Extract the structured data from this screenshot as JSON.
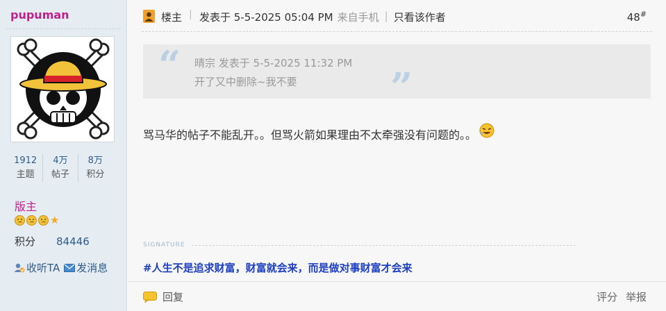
{
  "user": {
    "name": "pupuman",
    "stats": [
      {
        "value": "1912",
        "label": "主题"
      },
      {
        "value": "4万",
        "label": "帖子"
      },
      {
        "value": "8万",
        "label": "积分"
      }
    ],
    "role": "版主",
    "points_label": "积分",
    "points_value": "84446",
    "follow_label": "收听TA",
    "message_label": "发消息"
  },
  "post": {
    "op_label": "楼主",
    "posted_at": "发表于 5-5-2025 05:04 PM",
    "source": "来自手机",
    "only_author": "只看该作者",
    "floor": "48",
    "floor_mark": "#",
    "quote": {
      "meta": "晴宗 发表于 5-5-2025 11:32 PM",
      "text": "开了又中删除~我不要"
    },
    "content": "骂马华的帖子不能乱开。。但骂火箭如果理由不太牵强没有问题的。。",
    "signature_label": "SIGNATURE",
    "signature": "#人生不是追求财富，财富就会来，而是做对事财富才会来",
    "reply_label": "回复",
    "rate_label": "评分",
    "report_label": "举报"
  },
  "colors": {
    "username": "#c0208a",
    "sidebar_bg": "#e5edf2",
    "link": "#2f5a8a",
    "signature": "#1e3fbf"
  }
}
